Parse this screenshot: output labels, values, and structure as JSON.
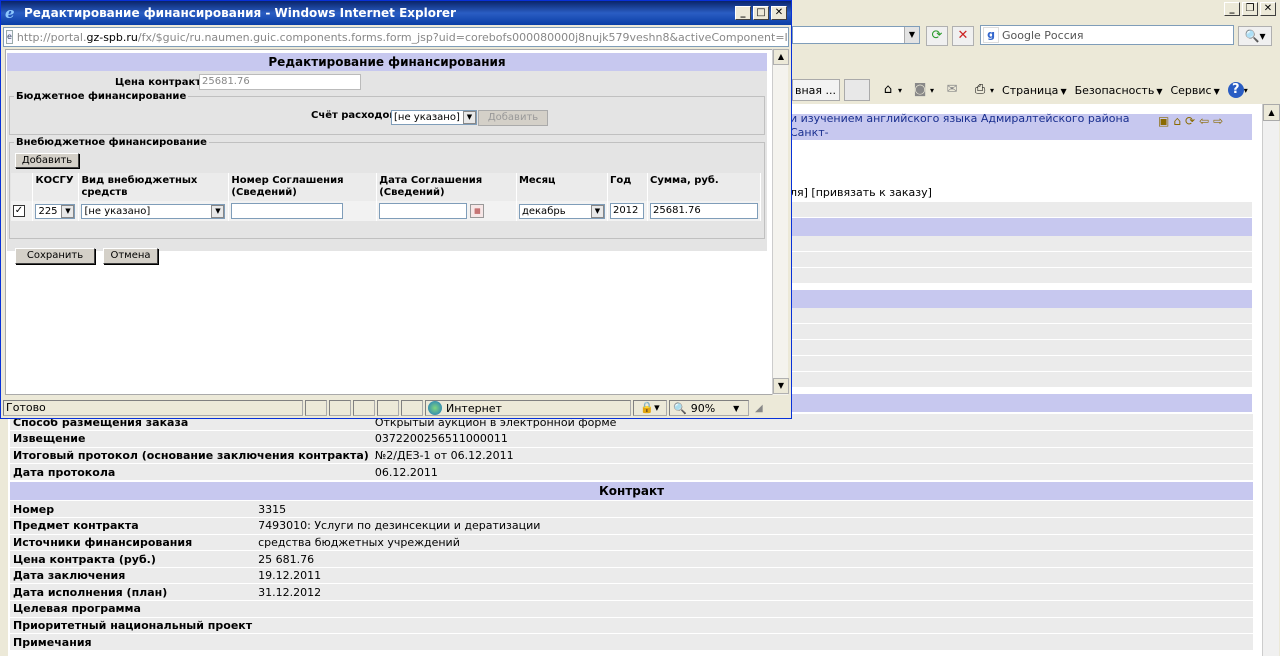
{
  "popup": {
    "title": "Редактирование финансирования - Windows Internet Explorer",
    "url_prefix": "http://portal.",
    "url_domain": "gz-spb.ru",
    "url_rest": "/fx/$guic/ru.naumen.guic.components.forms.form_jsp?uid=corebofs000080000j8nujk579veshn8&activeComponent=Item.editContra",
    "status_text": "Готово",
    "zone_label": "Интернет",
    "zoom_label": "90%"
  },
  "form": {
    "title": "Редактирование финансирования",
    "price_label": "Цена контракта",
    "price_value": "25681.76",
    "budget": {
      "legend": "Бюджетное финансирование",
      "account_label": "Счёт расходов",
      "account_value": "[не указано]",
      "add_label": "Добавить"
    },
    "offbudget": {
      "legend": "Внебюджетное финансирование",
      "add_label": "Добавить",
      "columns": [
        "КОСГУ",
        "Вид внебюджетных средств",
        "Номер Соглашения (Сведений)",
        "Дата Соглашения (Сведений)",
        "Месяц",
        "Год",
        "Сумма, руб."
      ],
      "row": {
        "checked_mark": "✓",
        "kosgu": "225",
        "fund_type": "[не указано]",
        "agreement_no": "",
        "agreement_date": "",
        "month": "декабрь",
        "year": "2012",
        "sum": "25681.76"
      }
    },
    "save_label": "Сохранить",
    "cancel_label": "Отмена"
  },
  "background": {
    "search_placeholder": "Google Россия",
    "tab_label": "вная ...",
    "toolbar": [
      "Страница",
      "Безопасность",
      "Сервис"
    ],
    "top_text": "и изучением английского языка Адмиралтейского района Санкт-",
    "link_line": "ля] [привязать к заказу]",
    "order_rows": [
      {
        "label": "Способ размещения заказа",
        "value": "Открытый аукцион в электронной форме"
      },
      {
        "label": "Извещение",
        "value": "0372200256511000011"
      },
      {
        "label": "Итоговый протокол (основание заключения контракта)",
        "value": "№2/ДЕЗ-1 от 06.12.2011"
      },
      {
        "label": "Дата протокола",
        "value": "06.12.2011"
      }
    ],
    "contract_title": "Контракт",
    "contract_rows": [
      {
        "label": "Номер",
        "value": "3315"
      },
      {
        "label": "Предмет контракта",
        "value": "7493010: Услуги по дезинсекции и дератизации"
      },
      {
        "label": "Источники финансирования",
        "value": "средства бюджетных учреждений"
      },
      {
        "label": "Цена контракта (руб.)",
        "value": "25 681.76"
      },
      {
        "label": "Дата заключения",
        "value": "19.12.2011"
      },
      {
        "label": "Дата исполнения (план)",
        "value": "31.12.2012"
      },
      {
        "label": "Целевая программа",
        "value": ""
      },
      {
        "label": "Приоритетный национальный проект",
        "value": ""
      },
      {
        "label": "Примечания",
        "value": ""
      }
    ]
  }
}
